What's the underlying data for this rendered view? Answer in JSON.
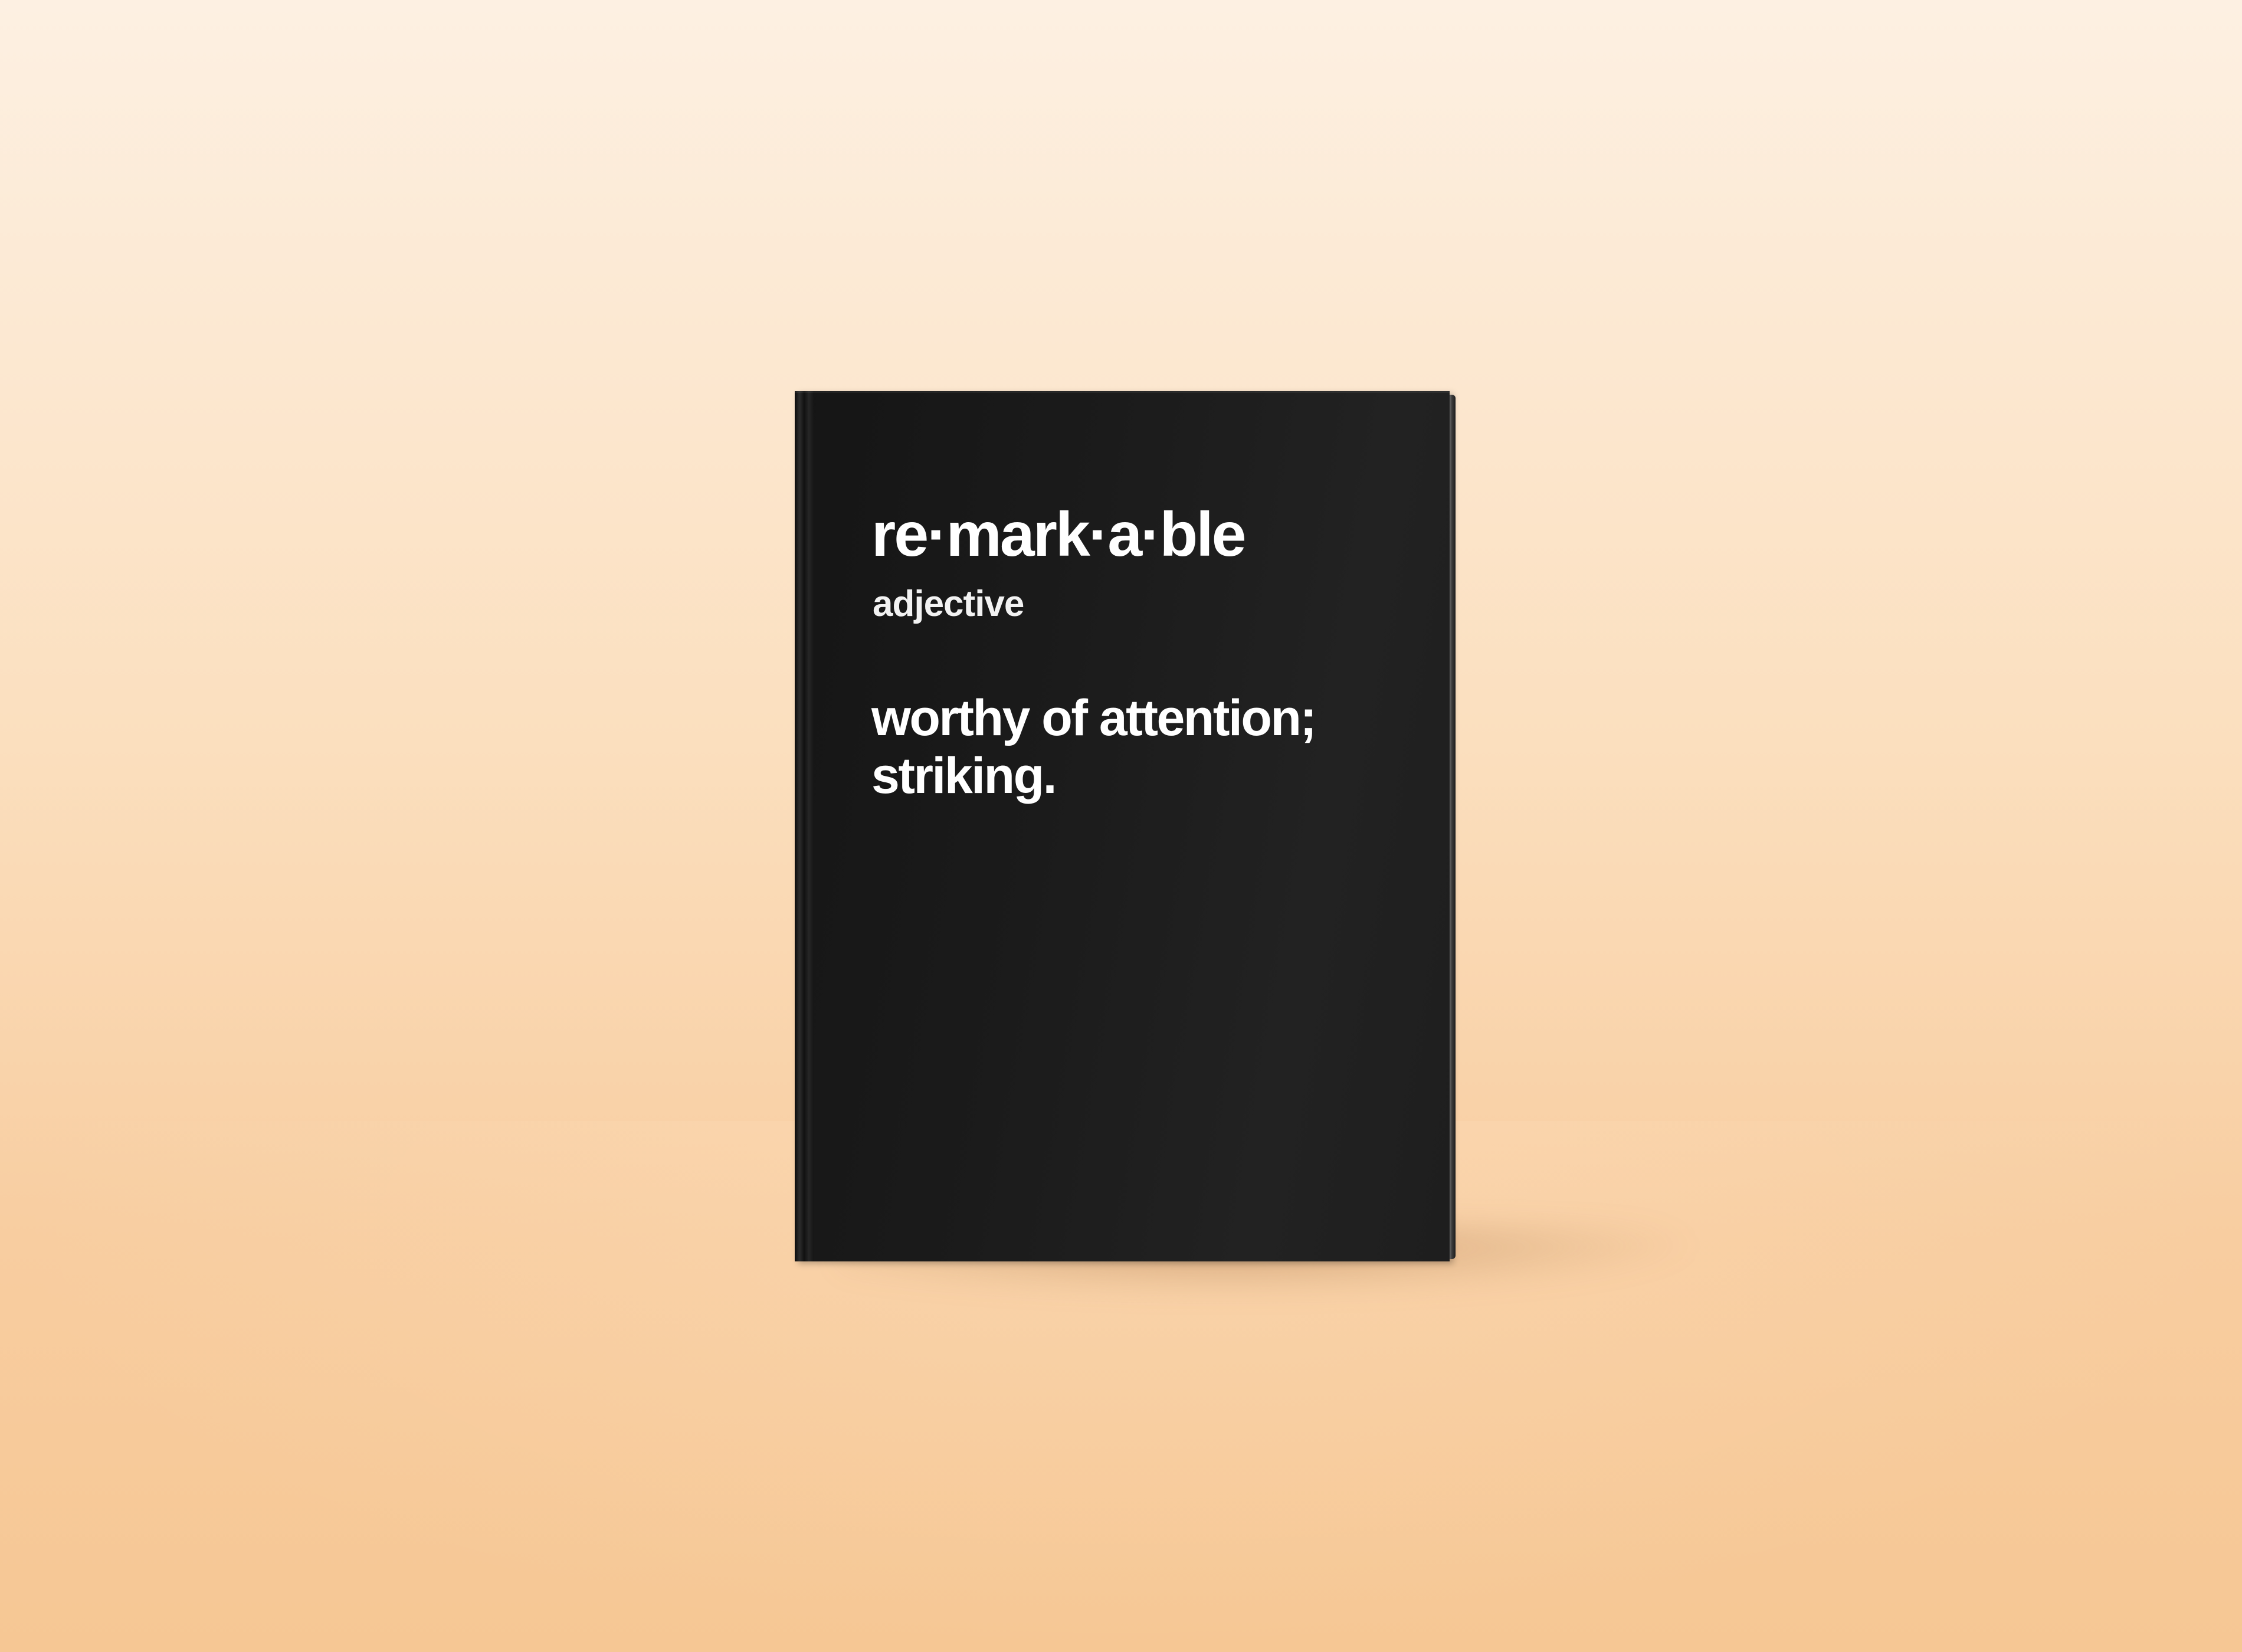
{
  "scene": {
    "background_top": "#fdf0e2",
    "background_bottom": "#f6c794",
    "book_cover_color": "#1b1b1b",
    "text_color": "#ffffff"
  },
  "cover": {
    "headword": "re·mark·a·ble",
    "part_of_speech": "adjective",
    "definition_lines": [
      "worthy of attention;",
      "striking."
    ]
  }
}
